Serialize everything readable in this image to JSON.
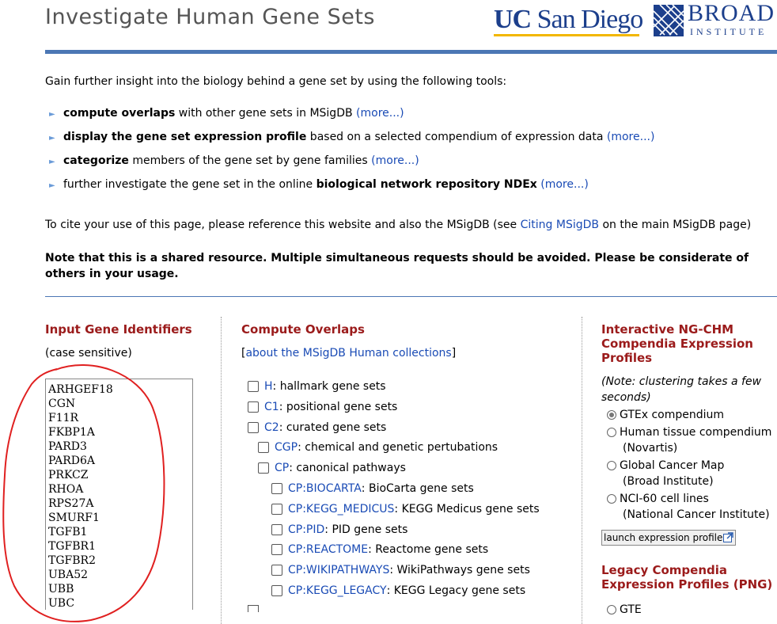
{
  "header": {
    "title": "Investigate Human Gene Sets",
    "ucsd_logo": {
      "uc": "UC",
      "rest": " San Diego"
    },
    "broad_logo": {
      "main": "BROAD",
      "sub": "INSTITUTE"
    }
  },
  "intro": "Gain further insight into the biology behind a gene set by using the following tools:",
  "tools": [
    {
      "bold": "compute overlaps",
      "text": " with other gene sets in MSigDB ",
      "link": "(more...)"
    },
    {
      "bold": "display the gene set expression profile",
      "text": " based on a selected compendium of expression data ",
      "link": "(more...)"
    },
    {
      "bold": "categorize",
      "text": " members of the gene set by gene families ",
      "link": "(more...)"
    },
    {
      "pre": "further investigate the gene set in the online ",
      "bold": "biological network repository NDEx",
      "text": " ",
      "link": "(more...)"
    }
  ],
  "cite": {
    "pre": "To cite your use of this page, please reference this website and also the MSigDB (see ",
    "link": "Citing MSigDB",
    "post": " on the main MSigDB page)"
  },
  "note": "Note that this is a shared resource. Multiple simultaneous requests should be avoided. Please be considerate of others in your usage.",
  "input_column": {
    "title": "Input Gene Identifiers",
    "case_note": "(case sensitive)",
    "genes": [
      "ARHGEF18",
      "CGN",
      "F11R",
      "FKBP1A",
      "PARD3",
      "PARD6A",
      "PRKCZ",
      "RHOA",
      "RPS27A",
      "SMURF1",
      "TGFB1",
      "TGFBR1",
      "TGFBR2",
      "UBA52",
      "UBB",
      "UBC"
    ]
  },
  "overlap_column": {
    "title": "Compute Overlaps",
    "about": {
      "open": "[",
      "link": "about the MSigDB Human collections",
      "close": "]"
    },
    "collections": [
      {
        "code": "H",
        "label": ": hallmark gene sets",
        "level": 0
      },
      {
        "code": "C1",
        "label": ": positional gene sets",
        "level": 0
      },
      {
        "code": "C2",
        "label": ": curated gene sets",
        "level": 0
      },
      {
        "code": "CGP",
        "label": ": chemical and genetic pertubations",
        "level": 1
      },
      {
        "code": "CP",
        "label": ": canonical pathways",
        "level": 1
      },
      {
        "code": "CP:BIOCARTA",
        "label": ": BioCarta gene sets",
        "level": 2
      },
      {
        "code": "CP:KEGG_MEDICUS",
        "label": ": KEGG Medicus gene sets",
        "level": 2
      },
      {
        "code": "CP:PID",
        "label": ": PID gene sets",
        "level": 2
      },
      {
        "code": "CP:REACTOME",
        "label": ": Reactome gene sets",
        "level": 2
      },
      {
        "code": "CP:WIKIPATHWAYS",
        "label": ": WikiPathways gene sets",
        "level": 2
      },
      {
        "code": "CP:KEGG_LEGACY",
        "label": ": KEGG Legacy gene sets",
        "level": 2
      }
    ]
  },
  "expression_column": {
    "title": "Interactive NG-CHM Compendia Expression Profiles",
    "note": "(Note: clustering takes a few seconds)",
    "options": [
      {
        "label": "GTEx compendium",
        "sub": "",
        "selected": true
      },
      {
        "label": "Human tissue compendium",
        "sub": "(Novartis)",
        "selected": false
      },
      {
        "label": "Global Cancer Map",
        "sub": "(Broad Institute)",
        "selected": false
      },
      {
        "label": "NCI-60 cell lines",
        "sub": "(National Cancer Institute)",
        "selected": false
      }
    ],
    "launch_button": "launch expression profile",
    "legacy_title": "Legacy Compendia Expression Profiles (PNG)",
    "legacy_cut_text": "GTE"
  },
  "colors": {
    "header_rule": "#4b77b4",
    "section_title": "#9b1b1b",
    "link": "#1a4bb5",
    "annotation": "#e02020"
  }
}
